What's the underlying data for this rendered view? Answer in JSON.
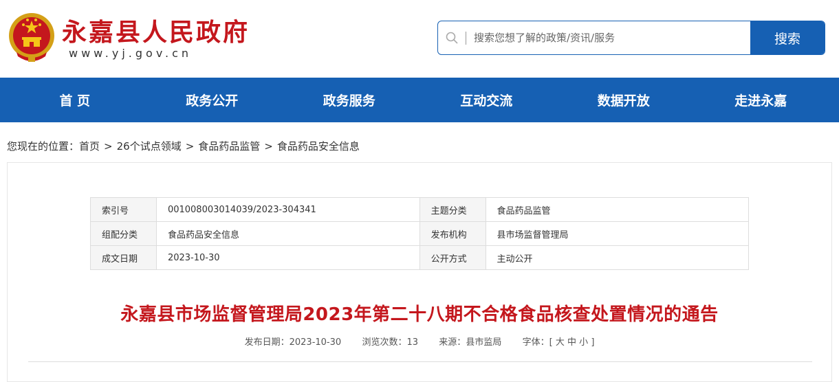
{
  "header": {
    "site_title": "永嘉县人民政府",
    "site_domain": "www.yj.gov.cn",
    "emblem_icon": "national-emblem-icon",
    "search": {
      "placeholder": "搜索您想了解的政策/资讯/服务",
      "button_label": "搜索"
    }
  },
  "nav": {
    "items": [
      {
        "label": "首 页"
      },
      {
        "label": "政务公开"
      },
      {
        "label": "政务服务"
      },
      {
        "label": "互动交流"
      },
      {
        "label": "数据开放"
      },
      {
        "label": "走进永嘉"
      }
    ]
  },
  "breadcrumb": {
    "prefix": "您现在的位置：",
    "items": [
      "首页",
      "26个试点领域",
      "食品药品监管",
      "食品药品安全信息"
    ],
    "separator": ">"
  },
  "meta": {
    "rows": [
      {
        "k1": "索引号",
        "v1": "001008003014039/2023-304341",
        "k2": "主题分类",
        "v2": "食品药品监管"
      },
      {
        "k1": "组配分类",
        "v1": "食品药品安全信息",
        "k2": "发布机构",
        "v2": "县市场监督管理局"
      },
      {
        "k1": "成文日期",
        "v1": "2023-10-30",
        "k2": "公开方式",
        "v2": "主动公开"
      }
    ]
  },
  "article": {
    "title": "永嘉县市场监督管理局2023年第二十八期不合格食品核查处置情况的通告",
    "publish_date_label": "发布日期：",
    "publish_date": "2023-10-30",
    "views_label": "浏览次数：",
    "views": "13",
    "source_label": "来源：",
    "source": "县市监局",
    "font_label": "字体：",
    "font_open": "[",
    "font_large": "大",
    "font_medium": "中",
    "font_small": "小",
    "font_close": "]"
  },
  "colors": {
    "brand_blue": "#1660b3",
    "brand_red": "#c4171d"
  }
}
